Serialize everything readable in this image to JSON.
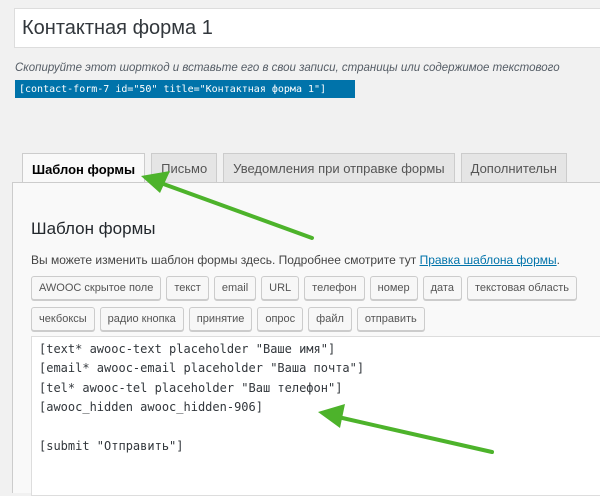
{
  "form_title": "Контактная форма 1",
  "shortcode_hint": "Скопируйте этот шорткод и вставьте его в свои записи, страницы или содержимое текстового",
  "shortcode": "[contact-form-7 id=\"50\" title=\"Контактная форма 1\"]",
  "tabs": [
    {
      "label": "Шаблон формы",
      "active": true
    },
    {
      "label": "Письмо",
      "active": false
    },
    {
      "label": "Уведомления при отправке формы",
      "active": false
    },
    {
      "label": "Дополнительн",
      "active": false
    }
  ],
  "panel": {
    "title": "Шаблон формы",
    "description": "Вы можете изменить шаблон формы здесь. Подробнее смотрите тут",
    "link_text": "Правка шаблона формы",
    "link_suffix": "."
  },
  "tag_buttons_row1": [
    "AWOOC скрытое поле",
    "текст",
    "email",
    "URL",
    "телефон",
    "номер",
    "дата",
    "текстовая область"
  ],
  "tag_buttons_row2": [
    "чекбоксы",
    "радио кнопка",
    "принятие",
    "опрос",
    "файл",
    "отправить"
  ],
  "form_code": "[text* awooc-text placeholder \"Ваше имя\"]\n[email* awooc-email placeholder \"Ваша почта\"]\n[tel* awooc-tel placeholder \"Ваш телефон\"]\n[awooc_hidden awooc_hidden-906]\n\n[submit \"Отправить\"]",
  "colors": {
    "accent": "#0073aa",
    "arrow": "#4db32b"
  }
}
